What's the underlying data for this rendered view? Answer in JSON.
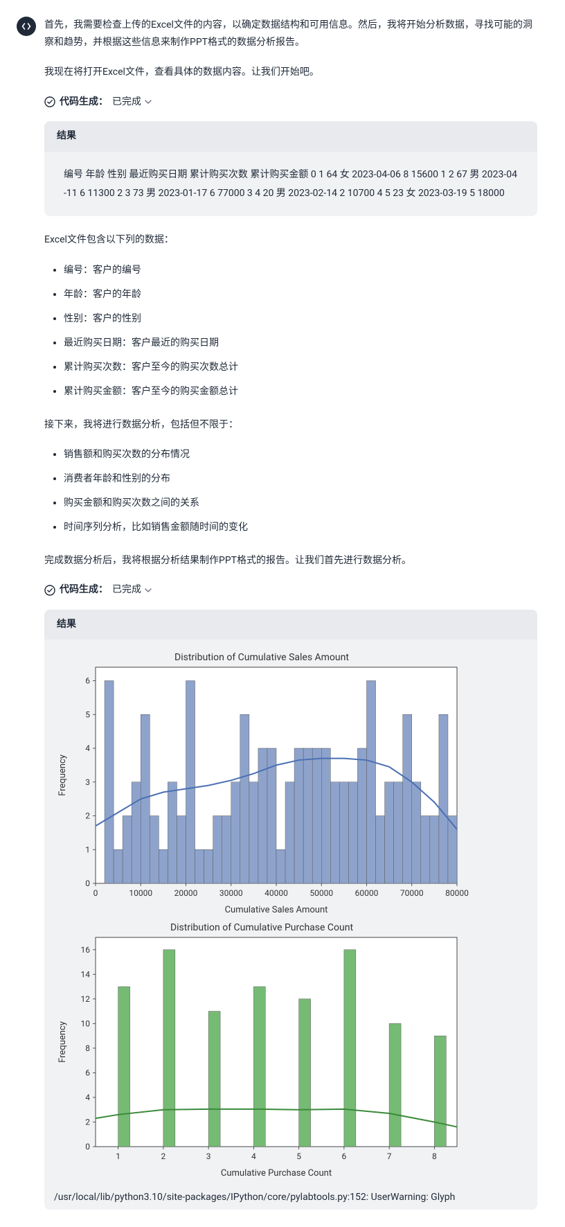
{
  "para1": "首先，我需要检查上传的Excel文件的内容，以确定数据结构和可用信息。然后，我将开始分析数据，寻找可能的洞察和趋势，并根据这些信息来制作PPT格式的数据分析报告。",
  "para2": "我现在将打开Excel文件，查看具体的数据内容。让我们开始吧。",
  "codegen_label": "代码生成：",
  "codegen_status": "已完成",
  "result_label": "结果",
  "result1_body": "编号 年龄 性别 最近购买日期 累计购买次数 累计购买金额 0 1 64 女 2023-04-06 8 15600 1 2 67 男 2023-04-11 6 11300 2 3 73 男 2023-01-17 6 77000 3 4 20 男 2023-02-14 2 10700 4 5 23 女 2023-03-19 5 18000",
  "para3": "Excel文件包含以下列的数据：",
  "list1": [
    "编号：客户的编号",
    "年龄：客户的年龄",
    "性别：客户的性别",
    "最近购买日期：客户最近的购买日期",
    "累计购买次数：客户至今的购买次数总计",
    "累计购买金额：客户至今的购买金额总计"
  ],
  "para4": "接下来，我将进行数据分析，包括但不限于：",
  "list2": [
    "销售额和购买次数的分布情况",
    "消费者年龄和性别的分布",
    "购买金额和购买次数之间的关系",
    "时间序列分析，比如销售金额随时间的变化"
  ],
  "para5": "完成数据分析后，我将根据分析结果制作PPT格式的报告。让我们首先进行数据分析。",
  "chart_data": [
    {
      "type": "bar",
      "title": "Distribution of Cumulative Sales Amount",
      "xlabel": "Cumulative Sales Amount",
      "ylabel": "Frequency",
      "xlim": [
        0,
        80000
      ],
      "ylim": [
        0,
        6.4
      ],
      "xticks": [
        0,
        10000,
        20000,
        30000,
        40000,
        50000,
        60000,
        70000,
        80000
      ],
      "yticks": [
        0,
        1,
        2,
        3,
        4,
        5,
        6
      ],
      "bar_color": "#8ea3cc",
      "bars": {
        "bin_width": 2000,
        "centers": [
          3000,
          5000,
          7000,
          9000,
          11000,
          13000,
          15000,
          17000,
          19000,
          21000,
          23000,
          25000,
          27000,
          29000,
          31000,
          33000,
          35000,
          37000,
          39000,
          41000,
          43000,
          45000,
          47000,
          49000,
          51000,
          53000,
          55000,
          57000,
          59000,
          61000,
          63000,
          65000,
          67000,
          69000,
          71000,
          73000,
          75000,
          77000,
          79000
        ],
        "values": [
          6,
          1,
          2,
          3,
          5,
          2,
          1,
          3,
          2,
          6,
          1,
          1,
          2,
          2,
          3,
          5,
          3,
          4,
          4,
          1,
          3,
          4,
          4,
          4,
          4,
          3,
          3,
          3,
          4,
          6,
          2,
          3,
          3,
          5,
          3,
          2,
          2,
          5,
          2
        ]
      },
      "kde_color": "#4a6fb3",
      "kde": [
        [
          0,
          1.7
        ],
        [
          5000,
          2.1
        ],
        [
          10000,
          2.5
        ],
        [
          15000,
          2.7
        ],
        [
          20000,
          2.8
        ],
        [
          25000,
          2.9
        ],
        [
          30000,
          3.05
        ],
        [
          35000,
          3.25
        ],
        [
          40000,
          3.5
        ],
        [
          45000,
          3.65
        ],
        [
          50000,
          3.7
        ],
        [
          55000,
          3.7
        ],
        [
          60000,
          3.65
        ],
        [
          65000,
          3.45
        ],
        [
          70000,
          3.0
        ],
        [
          75000,
          2.4
        ],
        [
          80000,
          1.6
        ]
      ]
    },
    {
      "type": "bar",
      "title": "Distribution of Cumulative Purchase Count",
      "xlabel": "Cumulative Purchase Count",
      "ylabel": "Frequency",
      "xlim": [
        0.5,
        8.5
      ],
      "ylim": [
        0,
        17
      ],
      "xticks": [
        1,
        2,
        3,
        4,
        5,
        6,
        7,
        8
      ],
      "yticks": [
        0,
        2,
        4,
        6,
        8,
        10,
        12,
        14,
        16
      ],
      "bar_color": "#76bb74",
      "bars": {
        "bin_width": 0.26,
        "centers": [
          1.13,
          2.13,
          3.13,
          4.13,
          5.13,
          6.13,
          7.13,
          8.13
        ],
        "values": [
          13,
          16,
          11,
          13,
          12,
          16,
          10,
          9
        ]
      },
      "kde_color": "#3a8a3a",
      "kde": [
        [
          0.5,
          2.3
        ],
        [
          1,
          2.6
        ],
        [
          2,
          3.0
        ],
        [
          3,
          3.05
        ],
        [
          4,
          3.05
        ],
        [
          5,
          3.0
        ],
        [
          6,
          3.05
        ],
        [
          7,
          2.7
        ],
        [
          8,
          2.0
        ],
        [
          8.5,
          1.6
        ]
      ]
    }
  ],
  "warning": "/usr/local/lib/python3.10/site-packages/IPython/core/pylabtools.py:152: UserWarning: Glyph"
}
